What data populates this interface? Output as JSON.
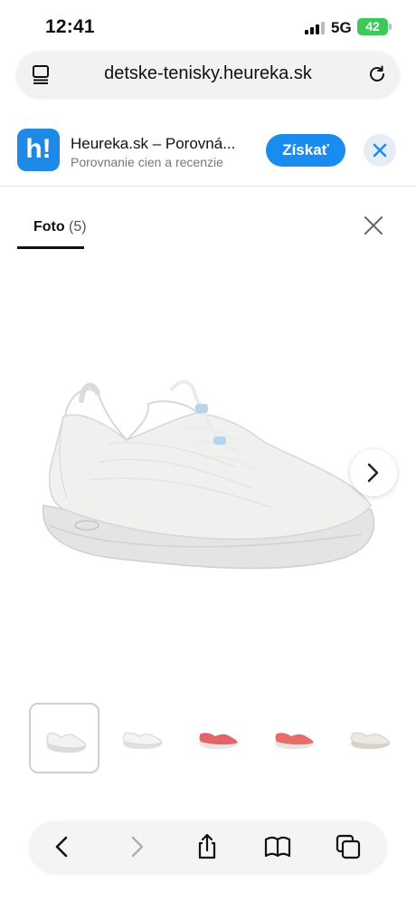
{
  "status_bar": {
    "time": "12:41",
    "network": "5G",
    "battery": "42"
  },
  "url_bar": {
    "url": "detske-tenisky.heureka.sk",
    "left_icon": "tab-list-icon",
    "right_icon": "reload-icon"
  },
  "app_banner": {
    "logo_text": "h!",
    "name": "Heureka.sk – Porovná...",
    "subtitle": "Porovnanie cien a recenzie",
    "get_label": "Získať",
    "close_icon": "close-icon"
  },
  "gallery": {
    "tab_label": "Foto",
    "tab_count": "(5)",
    "close_icon": "close-icon",
    "next_icon": "chevron-right-icon",
    "thumbnails": [
      {
        "color": "#e9e9e9",
        "active": true
      },
      {
        "color": "#eeeeee",
        "active": false
      },
      {
        "color": "#e2646a",
        "active": false
      },
      {
        "color": "#e86d66",
        "active": false
      },
      {
        "color": "#e6e1da",
        "active": false
      }
    ]
  },
  "colors": {
    "accent": "#1a8cf0",
    "logo": "#1e8ae6",
    "battery": "#3cc85a"
  },
  "toolbar": {
    "items": [
      "back-icon",
      "forward-icon",
      "share-icon",
      "bookmarks-icon",
      "tabs-icon"
    ]
  }
}
